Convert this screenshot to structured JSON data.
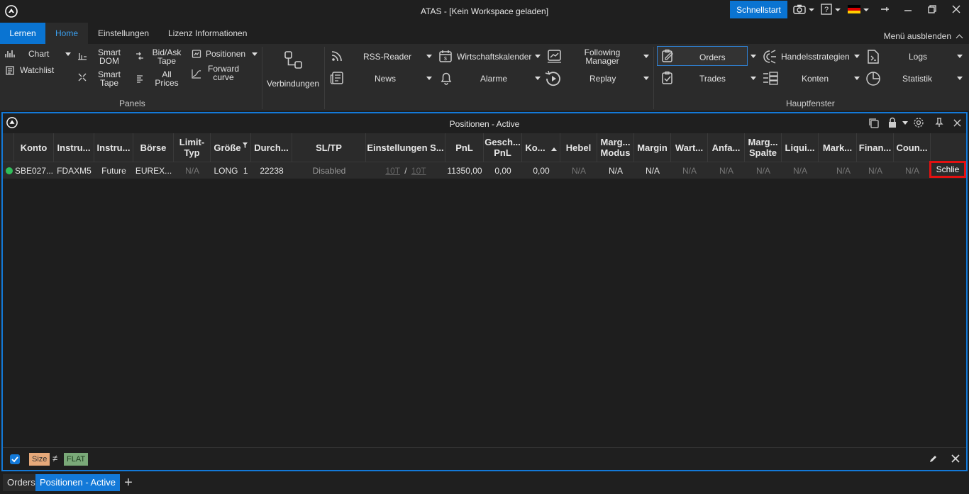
{
  "window": {
    "title": "ATAS - [Kein Workspace geladen]",
    "quickstart_label": "Schnellstart"
  },
  "menu": {
    "learn": "Lernen",
    "tabs": [
      "Home",
      "Einstellungen",
      "Lizenz Informationen"
    ],
    "hide_ribbon": "Menü ausblenden"
  },
  "ribbon": {
    "panels": {
      "group_label": "Panels",
      "chart": "Chart",
      "watchlist": "Watchlist",
      "smart_dom": "Smart\nDOM",
      "smart_tape": "Smart\nTape",
      "bid_ask_tape": "Bid/Ask\nTape",
      "all_prices": "All\nPrices",
      "positionen": "Positionen",
      "forward_curve": "Forward\ncurve"
    },
    "connections": "Verbindungen",
    "tools": {
      "rss": "RSS-Reader",
      "news": "News",
      "calendar": "Wirtschaftskalender",
      "alarms": "Alarme",
      "following_manager": "Following\nManager",
      "replay": "Replay"
    },
    "main_window": {
      "group_label": "Hauptfenster",
      "orders": "Orders",
      "trades": "Trades",
      "strategies": "Handelsstrategien",
      "accounts": "Konten",
      "logs": "Logs",
      "statistics": "Statistik"
    }
  },
  "panel": {
    "title": "Positionen - Active",
    "columns": [
      "Konto",
      "Instru...",
      "Instru...",
      "Börse",
      "Limit-\nTyp",
      "Größe",
      "Durch...",
      "SL/TP",
      "Einstellungen S...",
      "PnL",
      "Gesch...\nPnL",
      "Ko...",
      "Hebel",
      "Marg...\nModus",
      "Margin",
      "Wart...",
      "Anfa...",
      "Marg...\nSpalte",
      "Liqui...",
      "Mark...",
      "Finan...",
      "Coun..."
    ],
    "row": {
      "account": "SBE027...",
      "instrument": "FDAXM5",
      "instrument_type": "Future",
      "exchange": "EUREX...",
      "limit_type": "N/A",
      "direction": "LONG",
      "size": "1",
      "avg_price": "22238",
      "sltp": "Disabled",
      "settings_sl": "10T",
      "settings_sep": "/",
      "settings_tp": "10T",
      "pnl": "11350,00",
      "closed_pnl": "0,00",
      "commission": "0,00",
      "leverage": "N/A",
      "margin_mode": "N/A",
      "margin": "N/A",
      "wart": "N/A",
      "anfa": "N/A",
      "margin_column": "N/A",
      "liqui": "N/A",
      "mark": "N/A",
      "finan": "N/A",
      "coun": "N/A",
      "close_label": "Schlie"
    },
    "filter": {
      "field": "Size",
      "operator": "≠",
      "value": "FLAT"
    }
  },
  "bottom_tabs": {
    "orders": "Orders",
    "positions": "Positionen - Active",
    "add": "+"
  },
  "colors": {
    "accent": "#1379d8",
    "close_highlight": "#e31010",
    "status_ok": "#2fbe5a"
  }
}
